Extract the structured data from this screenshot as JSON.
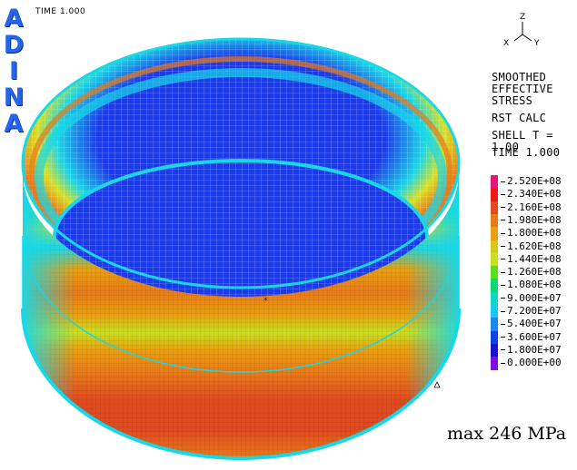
{
  "logo": {
    "letters": [
      "A",
      "D",
      "I",
      "N",
      "A"
    ]
  },
  "header": {
    "time_label": "TIME 1.000"
  },
  "triad": {
    "z": "Z",
    "x": "X",
    "y": "Y"
  },
  "info": {
    "line1": "SMOOTHED",
    "line2": "EFFECTIVE",
    "line3": "STRESS",
    "line4": "RST CALC",
    "line5": "SHELL T = 1.00",
    "line6": "TIME 1.000"
  },
  "legend": {
    "values": [
      "2.520E+08",
      "2.340E+08",
      "2.160E+08",
      "1.980E+08",
      "1.800E+08",
      "1.620E+08",
      "1.440E+08",
      "1.260E+08",
      "1.080E+08",
      "9.000E+07",
      "7.200E+07",
      "5.400E+07",
      "3.600E+07",
      "1.800E+07",
      "0.000E+00"
    ],
    "colors": [
      "#e8147c",
      "#f01818",
      "#e04a20",
      "#e87a1a",
      "#e8a010",
      "#d8c81a",
      "#c8e020",
      "#58e020",
      "#10d870",
      "#10d8c0",
      "#18c8f0",
      "#1888f0",
      "#1040e8",
      "#2010d0",
      "#8010e0"
    ]
  },
  "caption": "max 246 MPa",
  "colors": {
    "logo": "#2266ee",
    "base_mesh": "#1a3aef",
    "wall_cyan": "#18d8e8"
  }
}
